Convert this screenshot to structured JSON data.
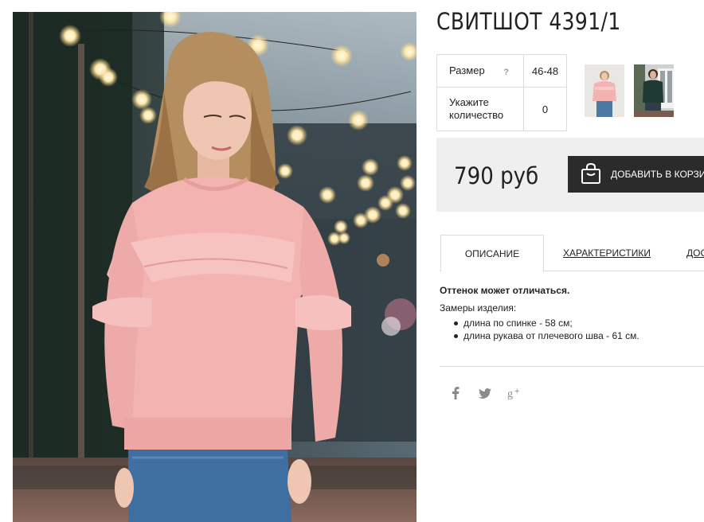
{
  "product": {
    "title": "СВИТШОТ 4391/1",
    "price": "790 руб",
    "buy_button": "ДОБАВИТЬ В КОРЗИНУ"
  },
  "options": {
    "size_label": "Размер",
    "size_help": "?",
    "size_value": "46-48",
    "qty_label_line1": "Укажите",
    "qty_label_line2": "количество",
    "qty_value": "0"
  },
  "tabs": {
    "description": "ОПИСАНИЕ",
    "characteristics": "ХАРАКТЕРИСТИКИ",
    "delivery": "ДОСТАВКА"
  },
  "description": {
    "note": "Оттенок может отличаться.",
    "measures_label": "Замеры изделия:",
    "items": [
      "длина по спинке - 58 см;",
      "длина рукава от плечевого шва - 61 см."
    ]
  },
  "social": {
    "facebook": "facebook-icon",
    "twitter": "twitter-icon",
    "googleplus": "googleplus-icon"
  },
  "colors": {
    "price_bg": "#efefef",
    "button_bg": "#2b2b2b",
    "sweatshirt": "#f2b3b1"
  }
}
